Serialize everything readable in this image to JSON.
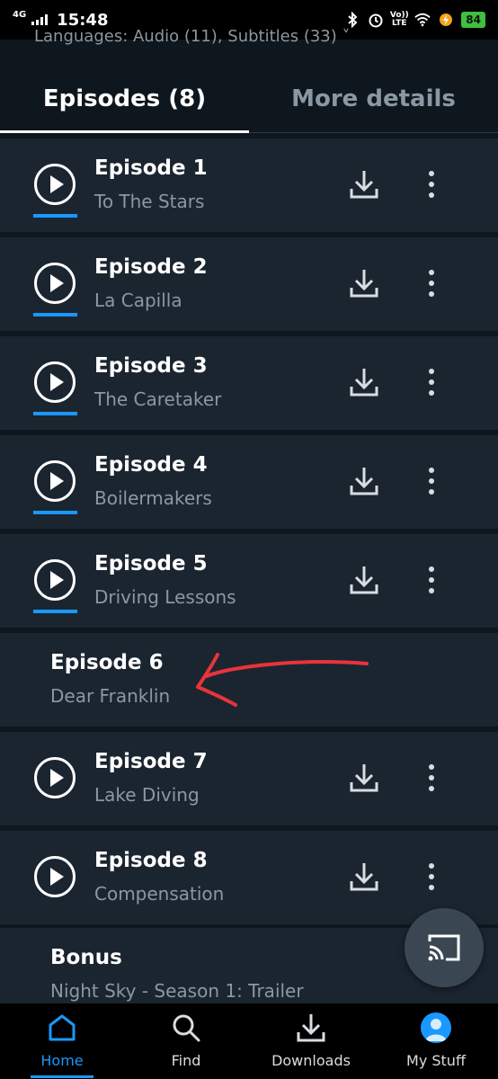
{
  "status_bar": {
    "network": "4G",
    "time": "15:48",
    "lte_top": "Vo))",
    "lte_bottom": "LTE",
    "battery": "84"
  },
  "header": {
    "languages_text": "Languages:  Audio (11), Subtitles (33) ˅"
  },
  "tabs": [
    {
      "label": "Episodes (8)",
      "active": true
    },
    {
      "label": "More details",
      "active": false
    }
  ],
  "episodes": [
    {
      "title": "Episode 1",
      "subtitle": "To The Stars",
      "playable": true,
      "watched": true
    },
    {
      "title": "Episode 2",
      "subtitle": "La Capilla",
      "playable": true,
      "watched": true
    },
    {
      "title": "Episode 3",
      "subtitle": "The Caretaker",
      "playable": true,
      "watched": true
    },
    {
      "title": "Episode 4",
      "subtitle": "Boilermakers",
      "playable": true,
      "watched": true
    },
    {
      "title": "Episode 5",
      "subtitle": "Driving Lessons",
      "playable": true,
      "watched": true
    },
    {
      "title": "Episode 6",
      "subtitle": "Dear Franklin",
      "playable": false,
      "watched": false
    },
    {
      "title": "Episode 7",
      "subtitle": "Lake Diving",
      "playable": true,
      "watched": false
    },
    {
      "title": "Episode 8",
      "subtitle": "Compensation",
      "playable": true,
      "watched": false
    }
  ],
  "bonus": {
    "title": "Bonus",
    "subtitle": "Night Sky - Season 1: Trailer"
  },
  "bottom_nav": [
    {
      "label": "Home",
      "icon": "home-icon",
      "active": true
    },
    {
      "label": "Find",
      "icon": "search-icon",
      "active": false
    },
    {
      "label": "Downloads",
      "icon": "download-icon",
      "active": false
    },
    {
      "label": "My Stuff",
      "icon": "avatar-icon",
      "active": false
    }
  ],
  "colors": {
    "background": "#0f171e",
    "row": "#1b2530",
    "accent": "#1a98ff",
    "muted_text": "#8a98a3",
    "annotation": "#e8343a"
  }
}
